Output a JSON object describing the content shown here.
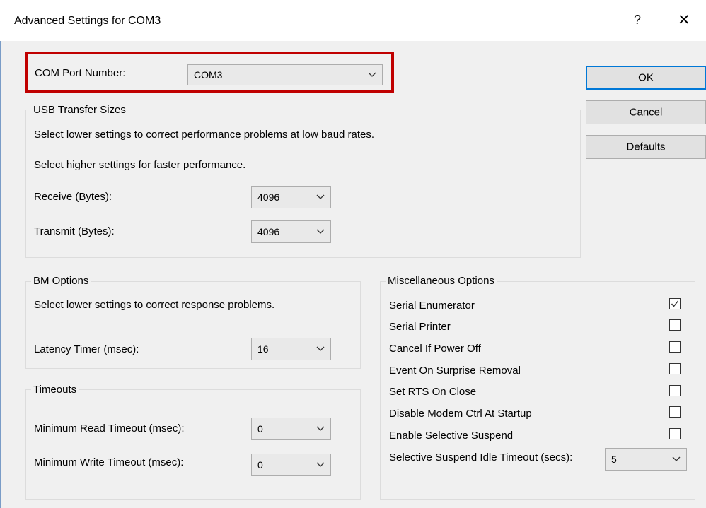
{
  "window": {
    "title": "Advanced Settings for COM3",
    "help_glyph": "?",
    "close_glyph": "✕"
  },
  "com_port": {
    "label": "COM Port Number:",
    "value": "COM3"
  },
  "buttons": {
    "ok": "OK",
    "cancel": "Cancel",
    "defaults": "Defaults"
  },
  "usb": {
    "title": "USB Transfer Sizes",
    "line1": "Select lower settings to correct performance problems at low baud rates.",
    "line2": "Select higher settings for faster performance.",
    "receive_label": "Receive (Bytes):",
    "receive_value": "4096",
    "transmit_label": "Transmit (Bytes):",
    "transmit_value": "4096"
  },
  "bm": {
    "title": "BM Options",
    "line1": "Select lower settings to correct response problems.",
    "latency_label": "Latency Timer (msec):",
    "latency_value": "16"
  },
  "timeouts": {
    "title": "Timeouts",
    "read_label": "Minimum Read Timeout (msec):",
    "read_value": "0",
    "write_label": "Minimum Write Timeout (msec):",
    "write_value": "0"
  },
  "misc": {
    "title": "Miscellaneous Options",
    "options": [
      {
        "label": "Serial Enumerator",
        "checked": true
      },
      {
        "label": "Serial Printer",
        "checked": false
      },
      {
        "label": "Cancel If Power Off",
        "checked": false
      },
      {
        "label": "Event On Surprise Removal",
        "checked": false
      },
      {
        "label": "Set RTS On Close",
        "checked": false
      },
      {
        "label": "Disable Modem Ctrl At Startup",
        "checked": false
      },
      {
        "label": "Enable Selective Suspend",
        "checked": false
      }
    ],
    "idle_label": "Selective Suspend Idle Timeout (secs):",
    "idle_value": "5"
  },
  "colors": {
    "highlight": "#c00000",
    "default_button_border": "#0078d7",
    "dialog_bg": "#f0f0f0"
  }
}
